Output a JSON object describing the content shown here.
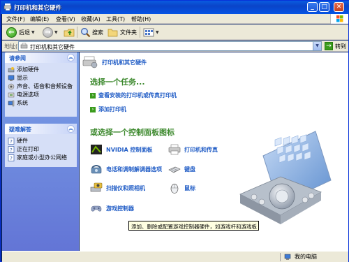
{
  "window": {
    "title": "打印机和其它硬件",
    "controls": {
      "minimize": "_",
      "maximize": "□",
      "close": "✕"
    }
  },
  "menu": [
    "文件(F)",
    "编辑(E)",
    "查看(V)",
    "收藏(A)",
    "工具(T)",
    "帮助(H)"
  ],
  "toolbar": {
    "back_label": "后退",
    "search_label": "搜索",
    "folders_label": "文件夹"
  },
  "address": {
    "label": "地址(D)",
    "value": "打印机和其它硬件",
    "go_label": "转到"
  },
  "sidebar": {
    "see_also": {
      "title": "请参阅",
      "items": [
        {
          "label": "添加硬件",
          "icon": "add-hardware-icon"
        },
        {
          "label": "显示",
          "icon": "display-icon"
        },
        {
          "label": "声音、语音和音频设备",
          "icon": "sound-icon"
        },
        {
          "label": "电源选项",
          "icon": "power-icon"
        },
        {
          "label": "系统",
          "icon": "system-icon"
        }
      ]
    },
    "troubleshoot": {
      "title": "疑难解答",
      "items": [
        {
          "label": "硬件",
          "icon": "help-icon"
        },
        {
          "label": "正在打印",
          "icon": "help-icon"
        },
        {
          "label": "家庭或小型办公网络",
          "icon": "help-icon"
        }
      ]
    }
  },
  "main": {
    "header": "打印机和其它硬件",
    "task_title": "选择一个任务...",
    "tasks": [
      "查看安装的打印机或传真打印机",
      "添加打印机"
    ],
    "cp_title": "或选择一个控制面板图标",
    "cp_items": [
      {
        "label": "NVIDIA 控制面板",
        "icon": "nvidia-icon"
      },
      {
        "label": "打印机和传真",
        "icon": "printer-icon"
      },
      {
        "label": "电话和调制解调器选项",
        "icon": "phone-icon"
      },
      {
        "label": "键盘",
        "icon": "keyboard-icon"
      },
      {
        "label": "扫描仪和照相机",
        "icon": "scanner-icon"
      },
      {
        "label": "鼠标",
        "icon": "mouse-icon"
      },
      {
        "label": "游戏控制器",
        "icon": "gamepad-icon"
      }
    ],
    "tooltip": "添加、删除或配置游戏控制器硬件，如游戏杆和游戏板"
  },
  "status": {
    "computer": "我的电脑"
  },
  "colors": {
    "title_blue": "#0a5be0",
    "link_blue": "#215dc6",
    "section_green": "#3e8a2f",
    "sidebar_bg": "#6375d6"
  }
}
